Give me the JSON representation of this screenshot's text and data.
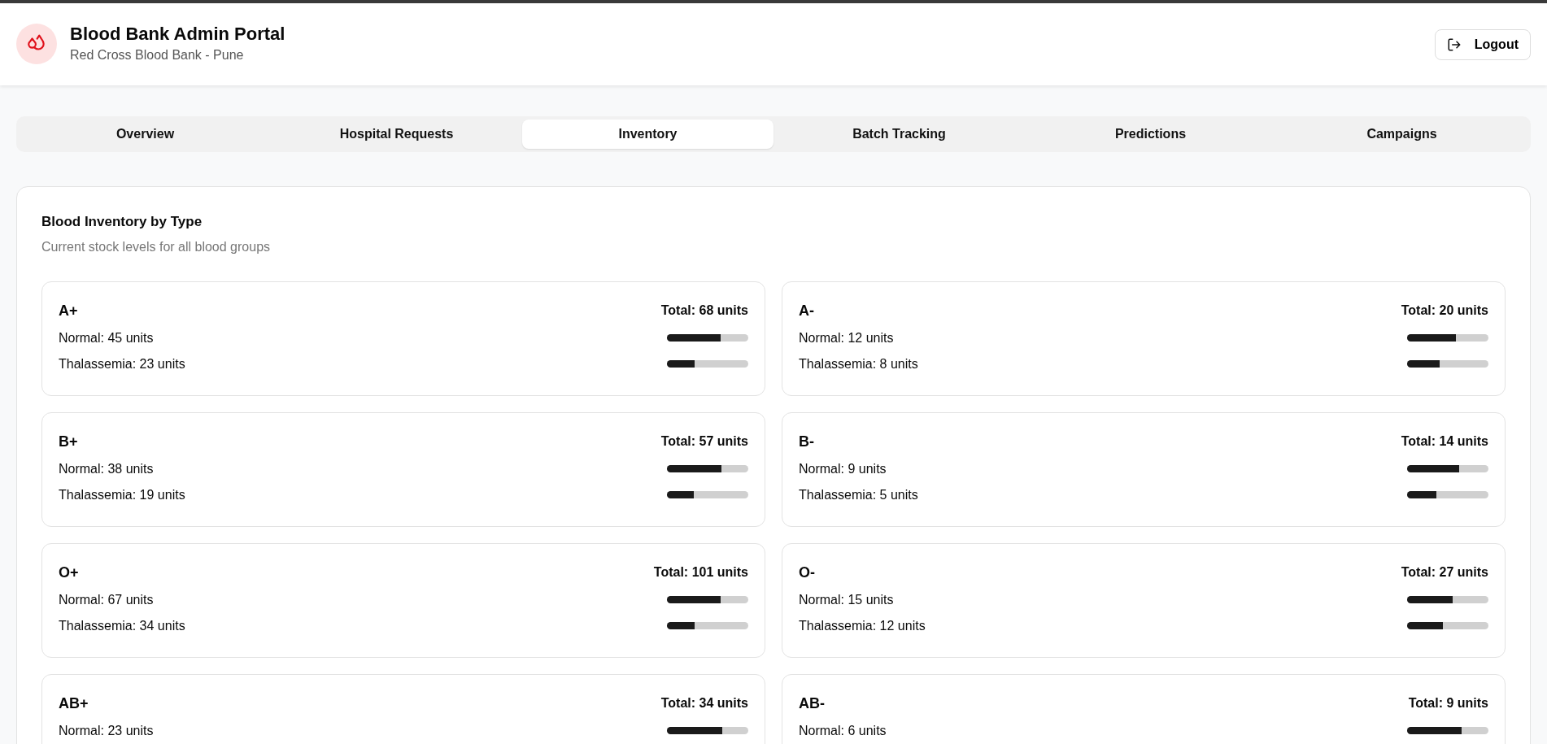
{
  "header": {
    "title": "Blood Bank Admin Portal",
    "subtitle": "Red Cross Blood Bank - Pune",
    "logout": "Logout"
  },
  "tabs": [
    {
      "label": "Overview",
      "selected": false
    },
    {
      "label": "Hospital Requests",
      "selected": false
    },
    {
      "label": "Inventory",
      "selected": true
    },
    {
      "label": "Batch Tracking",
      "selected": false
    },
    {
      "label": "Predictions",
      "selected": false
    },
    {
      "label": "Campaigns",
      "selected": false
    }
  ],
  "inventory": {
    "title": "Blood Inventory by Type",
    "subtitle": "Current stock levels for all blood groups",
    "groups": [
      {
        "type": "A+",
        "total": "Total: 68 units",
        "rows": [
          {
            "label": "Normal: 45 units",
            "level": 0.66
          },
          {
            "label": "Thalassemia: 23 units",
            "level": 0.34
          }
        ]
      },
      {
        "type": "A-",
        "total": "Total: 20 units",
        "rows": [
          {
            "label": "Normal: 12 units",
            "level": 0.6
          },
          {
            "label": "Thalassemia: 8 units",
            "level": 0.4
          }
        ]
      },
      {
        "type": "B+",
        "total": "Total: 57 units",
        "rows": [
          {
            "label": "Normal: 38 units",
            "level": 0.67
          },
          {
            "label": "Thalassemia: 19 units",
            "level": 0.33
          }
        ]
      },
      {
        "type": "B-",
        "total": "Total: 14 units",
        "rows": [
          {
            "label": "Normal: 9 units",
            "level": 0.64
          },
          {
            "label": "Thalassemia: 5 units",
            "level": 0.36
          }
        ]
      },
      {
        "type": "O+",
        "total": "Total: 101 units",
        "rows": [
          {
            "label": "Normal: 67 units",
            "level": 0.66
          },
          {
            "label": "Thalassemia: 34 units",
            "level": 0.34
          }
        ]
      },
      {
        "type": "O-",
        "total": "Total: 27 units",
        "rows": [
          {
            "label": "Normal: 15 units",
            "level": 0.56
          },
          {
            "label": "Thalassemia: 12 units",
            "level": 0.44
          }
        ]
      },
      {
        "type": "AB+",
        "total": "Total: 34 units",
        "rows": [
          {
            "label": "Normal: 23 units",
            "level": 0.68
          }
        ]
      },
      {
        "type": "AB-",
        "total": "Total: 9 units",
        "rows": [
          {
            "label": "Normal: 6 units",
            "level": 0.67
          }
        ]
      }
    ]
  }
}
